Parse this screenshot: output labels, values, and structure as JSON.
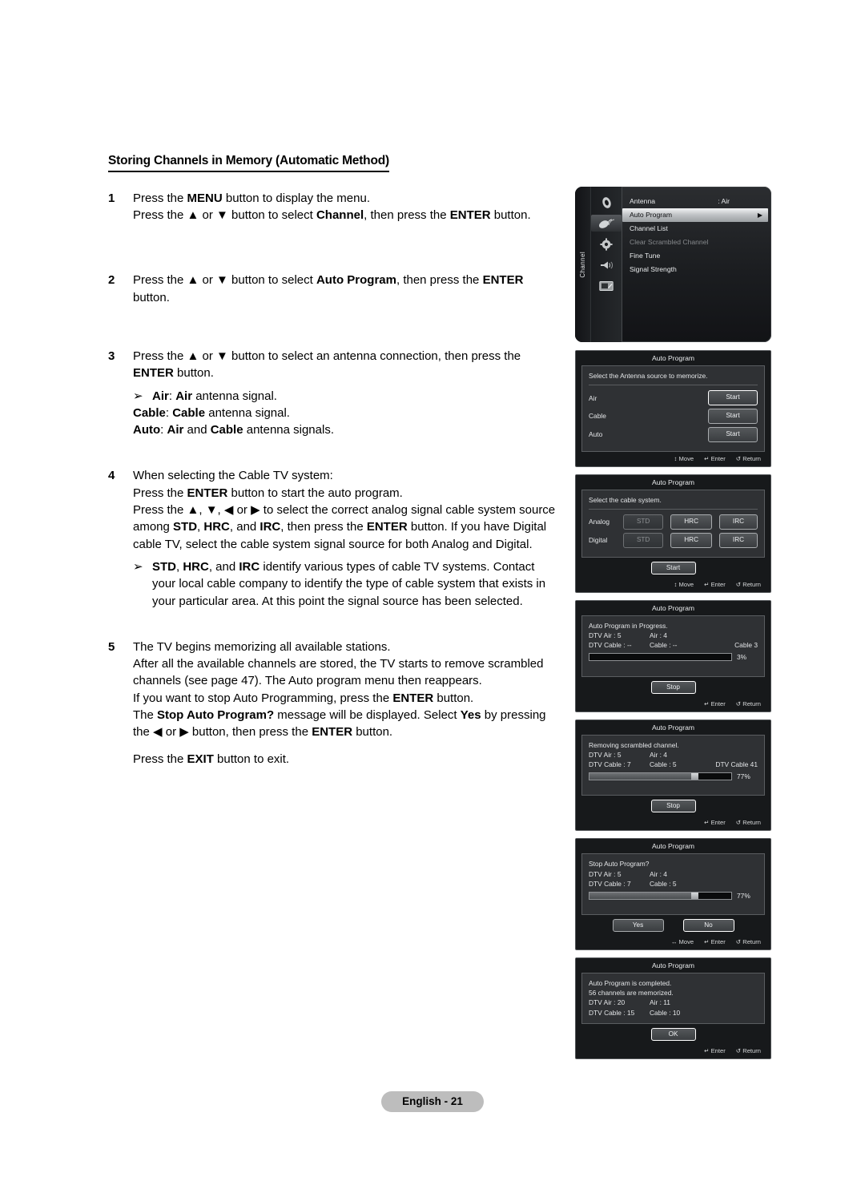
{
  "page": {
    "heading": "Storing Channels in Memory (Automatic Method)",
    "footer_label": "English - 21"
  },
  "steps": [
    {
      "num": "1",
      "lines": [
        [
          {
            "t": "Press the "
          },
          {
            "t": "MENU",
            "b": true
          },
          {
            "t": " button to display the menu."
          }
        ],
        [
          {
            "t": "Press the ▲ or ▼ button to select "
          },
          {
            "t": "Channel",
            "b": true
          },
          {
            "t": ", then press the "
          },
          {
            "t": "ENTER",
            "b": true
          },
          {
            "t": " button."
          }
        ]
      ]
    },
    {
      "num": "2",
      "lines": [
        [
          {
            "t": "Press the ▲ or ▼ button to select "
          },
          {
            "t": "Auto Program",
            "b": true
          },
          {
            "t": ", then press the "
          },
          {
            "t": "ENTER",
            "b": true
          }
        ],
        [
          {
            "t": "button."
          }
        ]
      ]
    },
    {
      "num": "3",
      "lines": [
        [
          {
            "t": "Press the ▲ or ▼ button to select an antenna connection, then press the"
          }
        ],
        [
          {
            "t": "ENTER",
            "b": true
          },
          {
            "t": " button."
          }
        ]
      ],
      "bullets": [
        {
          "mark": "➢",
          "lines": [
            [
              {
                "t": "Air",
                "b": true
              },
              {
                "t": ": "
              },
              {
                "t": "Air",
                "b": true
              },
              {
                "t": " antenna signal."
              }
            ]
          ]
        }
      ],
      "indented": [
        [
          {
            "t": "Cable",
            "b": true
          },
          {
            "t": ": "
          },
          {
            "t": "Cable",
            "b": true
          },
          {
            "t": " antenna signal."
          }
        ],
        [
          {
            "t": "Auto",
            "b": true
          },
          {
            "t": ": "
          },
          {
            "t": "Air",
            "b": true
          },
          {
            "t": " and "
          },
          {
            "t": "Cable",
            "b": true
          },
          {
            "t": " antenna signals."
          }
        ]
      ]
    },
    {
      "num": "4",
      "lines": [
        [
          {
            "t": "When selecting the Cable TV system:"
          }
        ],
        [
          {
            "t": "Press the "
          },
          {
            "t": "ENTER",
            "b": true
          },
          {
            "t": " button to start the auto program."
          }
        ],
        [
          {
            "t": "Press the ▲, ▼, ◀ or ▶ to select the correct analog signal cable system source"
          }
        ],
        [
          {
            "t": "among "
          },
          {
            "t": "STD",
            "b": true
          },
          {
            "t": ", "
          },
          {
            "t": "HRC",
            "b": true
          },
          {
            "t": ", and "
          },
          {
            "t": "IRC",
            "b": true
          },
          {
            "t": ", then press the "
          },
          {
            "t": "ENTER",
            "b": true
          },
          {
            "t": " button. If you have Digital"
          }
        ],
        [
          {
            "t": "cable TV, select the cable system signal source for both Analog and Digital."
          }
        ]
      ],
      "bullets": [
        {
          "mark": "➢",
          "lines": [
            [
              {
                "t": "STD",
                "b": true
              },
              {
                "t": ", "
              },
              {
                "t": "HRC",
                "b": true
              },
              {
                "t": ", and "
              },
              {
                "t": "IRC",
                "b": true
              },
              {
                "t": " identify various types of cable TV systems. Contact"
              }
            ],
            [
              {
                "t": "your local cable company to identify the type of cable system that exists in"
              }
            ],
            [
              {
                "t": "your particular area. At this point the signal source has been selected."
              }
            ]
          ]
        }
      ]
    },
    {
      "num": "5",
      "lines": [
        [
          {
            "t": "The TV begins memorizing all available stations."
          }
        ],
        [
          {
            "t": "After all the available channels are stored, the TV starts to remove scrambled"
          }
        ],
        [
          {
            "t": "channels (see page 47). The Auto program menu then reappears."
          }
        ],
        [
          {
            "t": "If you want to stop Auto Programming, press the "
          },
          {
            "t": "ENTER",
            "b": true
          },
          {
            "t": " button."
          }
        ],
        [
          {
            "t": "The "
          },
          {
            "t": "Stop Auto Program?",
            "b": true
          },
          {
            "t": " message will be displayed. Select "
          },
          {
            "t": "Yes",
            "b": true
          },
          {
            "t": " by pressing"
          }
        ],
        [
          {
            "t": "the ◀ or ▶ button, then press the "
          },
          {
            "t": "ENTER",
            "b": true
          },
          {
            "t": " button."
          }
        ]
      ],
      "tail": [
        [
          {
            "t": "Press the "
          },
          {
            "t": "EXIT",
            "b": true
          },
          {
            "t": " button to exit."
          }
        ]
      ]
    }
  ],
  "osd": {
    "menu": {
      "rail_label": "Channel",
      "icons": [
        "picture-icon",
        "channel-dish-icon",
        "setup-gear-icon",
        "sound-speaker-icon",
        "input-source-icon"
      ],
      "rows": [
        {
          "label": "Antenna",
          "value": ": Air",
          "state": "normal"
        },
        {
          "label": "Auto Program",
          "value": "",
          "state": "selected",
          "caret": "▶"
        },
        {
          "label": "Channel List",
          "value": "",
          "state": "normal"
        },
        {
          "label": "Clear Scrambled Channel",
          "value": "",
          "state": "dim"
        },
        {
          "label": "Fine Tune",
          "value": "",
          "state": "normal"
        },
        {
          "label": "Signal Strength",
          "value": "",
          "state": "normal"
        }
      ]
    },
    "hints": {
      "move_ud": "↕ Move",
      "move_lr": "↔ Move",
      "enter": "↵ Enter",
      "return": "↺ Return"
    },
    "antenna_dialog": {
      "title": "Auto Program",
      "prompt": "Select the Antenna source to memorize.",
      "rows": [
        {
          "label": "Air",
          "button": "Start",
          "focused": true
        },
        {
          "label": "Cable",
          "button": "Start",
          "focused": false
        },
        {
          "label": "Auto",
          "button": "Start",
          "focused": false
        }
      ],
      "hints": [
        "↕ Move",
        "↵ Enter",
        "↺ Return"
      ]
    },
    "cable_dialog": {
      "title": "Auto Program",
      "prompt": "Select the cable system.",
      "rows": [
        {
          "label": "Analog",
          "options": [
            {
              "text": "STD",
              "state": "dim"
            },
            {
              "text": "HRC",
              "state": "normal"
            },
            {
              "text": "IRC",
              "state": "normal"
            }
          ]
        },
        {
          "label": "Digital",
          "options": [
            {
              "text": "STD",
              "state": "dim"
            },
            {
              "text": "HRC",
              "state": "normal"
            },
            {
              "text": "IRC",
              "state": "normal"
            }
          ]
        }
      ],
      "action": "Start",
      "hints": [
        "↕ Move",
        "↵ Enter",
        "↺ Return"
      ]
    },
    "progress_dialog": {
      "title": "Auto Program",
      "message": "Auto Program in Progress.",
      "stats": [
        {
          "left": "DTV Air : 5",
          "mid": "Air : 4",
          "right": ""
        },
        {
          "left": "DTV Cable : --",
          "mid": "Cable : --",
          "right": "Cable 3"
        }
      ],
      "progress_percent": 3,
      "progress_label": "3%",
      "action": "Stop",
      "hints": [
        "↵ Enter",
        "↺ Return"
      ]
    },
    "scramble_dialog": {
      "title": "Auto Program",
      "message": "Removing scrambled channel.",
      "stats": [
        {
          "left": "DTV Air : 5",
          "mid": "Air : 4",
          "right": ""
        },
        {
          "left": "DTV Cable : 7",
          "mid": "Cable : 5",
          "right": "DTV Cable 41"
        }
      ],
      "progress_percent": 77,
      "progress_label": "77%",
      "action": "Stop",
      "hints": [
        "↵ Enter",
        "↺ Return"
      ]
    },
    "stop_dialog": {
      "title": "Auto Program",
      "message": "Stop Auto Program?",
      "stats": [
        {
          "left": "DTV Air : 5",
          "mid": "Air : 4",
          "right": ""
        },
        {
          "left": "DTV Cable : 7",
          "mid": "Cable : 5",
          "right": ""
        }
      ],
      "progress_percent": 77,
      "progress_label": "77%",
      "yes_label": "Yes",
      "no_label": "No",
      "hints": [
        "↔ Move",
        "↵ Enter",
        "↺ Return"
      ]
    },
    "complete_dialog": {
      "title": "Auto Program",
      "message_1": "Auto Program is completed.",
      "message_2": "56 channels are memorized.",
      "stats": [
        {
          "left": "DTV Air : 20",
          "mid": "Air : 11"
        },
        {
          "left": "DTV Cable : 15",
          "mid": "Cable : 10"
        }
      ],
      "action": "OK",
      "hints": [
        "↵ Enter",
        "↺ Return"
      ]
    }
  },
  "colors": {
    "osd_bg": "#17191b",
    "osd_body": "#2f3134",
    "osd_text": "#e4e6e8",
    "footer_pill": "#bdbdbd"
  }
}
